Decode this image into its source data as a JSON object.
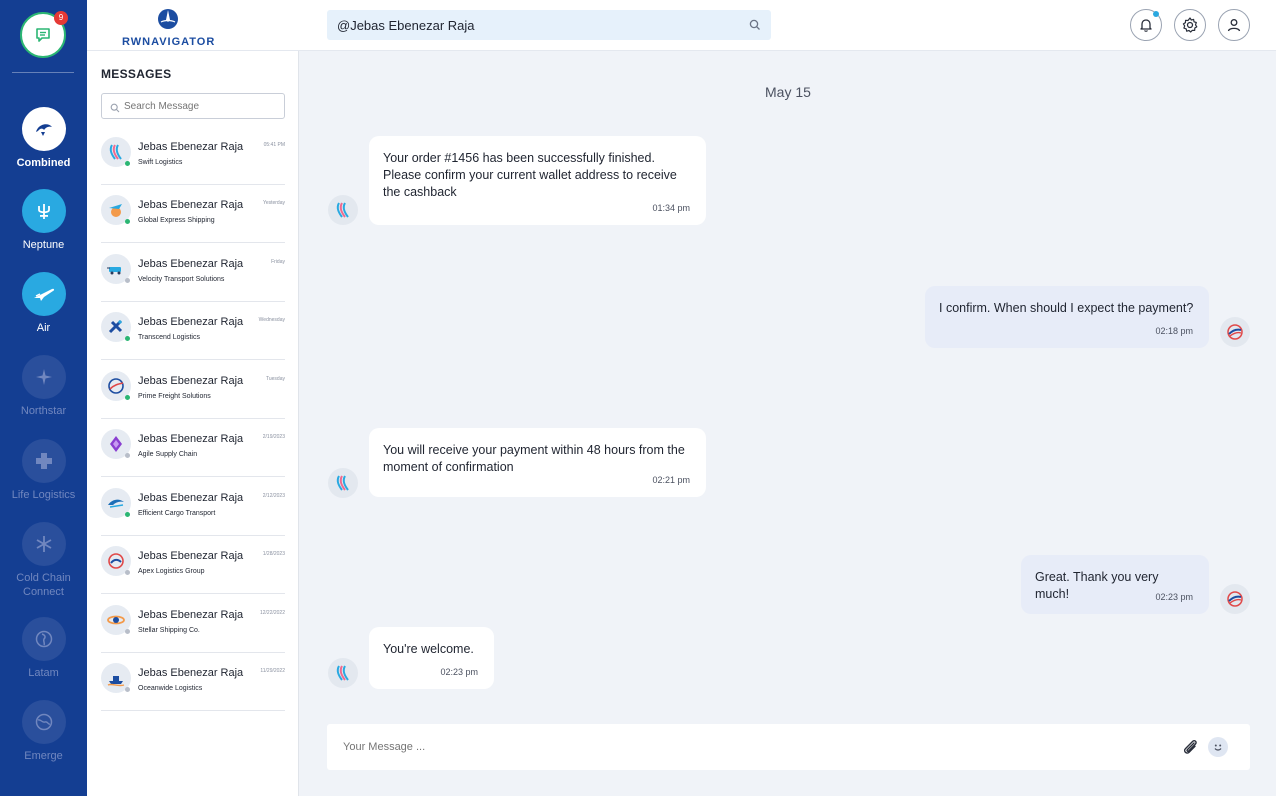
{
  "app": {
    "logo_text": "RWNAVIGATOR",
    "search_value": "@Jebas Ebenezar Raja",
    "chat_badge_count": "9"
  },
  "rail": {
    "items": [
      {
        "label": "Combined",
        "icon": "combined-logo-icon"
      },
      {
        "label": "Neptune",
        "icon": "trident-icon"
      },
      {
        "label": "Air",
        "icon": "plane-icon"
      },
      {
        "label": "Northstar",
        "icon": "star-icon"
      },
      {
        "label": "Life Logistics",
        "icon": "cross-icon"
      },
      {
        "label": "Cold Chain Connect",
        "icon": "snowflake-icon"
      },
      {
        "label": "Latam",
        "icon": "globe-americas-icon"
      },
      {
        "label": "Emerge",
        "icon": "globe-icon"
      }
    ]
  },
  "messages": {
    "title": "MESSAGES",
    "search_placeholder": "Search Message",
    "contacts": [
      {
        "name": "Jebas Ebenezar Raja",
        "company": "Swift Logistics",
        "time": "05:41 PM",
        "status": "online"
      },
      {
        "name": "Jebas Ebenezar Raja",
        "company": "Global Express Shipping",
        "time": "Yesterday",
        "status": "online"
      },
      {
        "name": "Jebas Ebenezar Raja",
        "company": "Velocity Transport Solutions",
        "time": "Friday",
        "status": "offline"
      },
      {
        "name": "Jebas Ebenezar Raja",
        "company": "Transcend Logistics",
        "time": "Wednesday",
        "status": "online"
      },
      {
        "name": "Jebas Ebenezar Raja",
        "company": "Prime Freight Solutions",
        "time": "Tuesday",
        "status": "online"
      },
      {
        "name": "Jebas Ebenezar Raja",
        "company": "Agile Supply Chain",
        "time": "2/19/2023",
        "status": "offline"
      },
      {
        "name": "Jebas Ebenezar Raja",
        "company": "Efficient Cargo Transport",
        "time": "2/12/2023",
        "status": "online"
      },
      {
        "name": "Jebas Ebenezar Raja",
        "company": "Apex Logistics Group",
        "time": "1/28/2023",
        "status": "offline"
      },
      {
        "name": "Jebas Ebenezar Raja",
        "company": "Stellar Shipping Co.",
        "time": "12/22/2022",
        "status": "offline"
      },
      {
        "name": "Jebas Ebenezar Raja",
        "company": "Oceanwide Logistics",
        "time": "11/29/2022",
        "status": "offline"
      }
    ]
  },
  "chat": {
    "date": "May 15",
    "messages": [
      {
        "direction": "in",
        "text": "Your order #1456 has been successfully finished. Please confirm your current wallet address to receive the cashback",
        "time": "01:34 pm"
      },
      {
        "direction": "out",
        "text": "I confirm. When should I expect the payment?",
        "time": "02:18 pm"
      },
      {
        "direction": "in",
        "text": "You will receive your payment within 48 hours from the moment of confirmation",
        "time": "02:21 pm"
      },
      {
        "direction": "out",
        "text": "Great. Thank you very much!",
        "time": "02:23 pm"
      },
      {
        "direction": "in",
        "text": "You're welcome.",
        "time": "02:23 pm"
      }
    ],
    "composer_placeholder": "Your Message ..."
  },
  "colors": {
    "rail_bg": "#143e92",
    "accent_blue": "#29a9e1",
    "online": "#2bb673",
    "offline": "#b8bec9",
    "badge": "#e53935"
  }
}
